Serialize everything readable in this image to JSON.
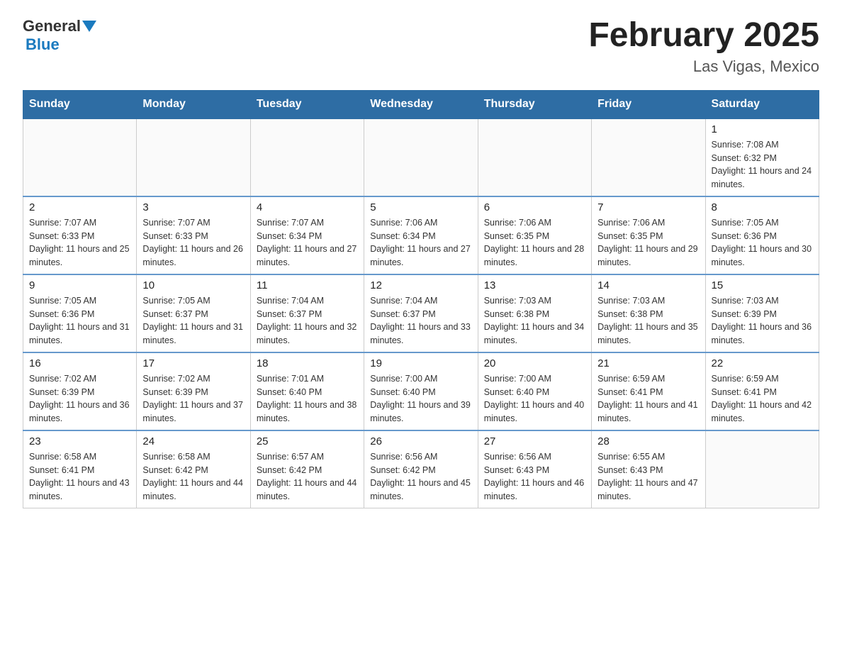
{
  "header": {
    "logo_general": "General",
    "logo_blue": "Blue",
    "title": "February 2025",
    "subtitle": "Las Vigas, Mexico"
  },
  "weekdays": [
    "Sunday",
    "Monday",
    "Tuesday",
    "Wednesday",
    "Thursday",
    "Friday",
    "Saturday"
  ],
  "weeks": [
    [
      {
        "day": "",
        "info": ""
      },
      {
        "day": "",
        "info": ""
      },
      {
        "day": "",
        "info": ""
      },
      {
        "day": "",
        "info": ""
      },
      {
        "day": "",
        "info": ""
      },
      {
        "day": "",
        "info": ""
      },
      {
        "day": "1",
        "info": "Sunrise: 7:08 AM\nSunset: 6:32 PM\nDaylight: 11 hours and 24 minutes."
      }
    ],
    [
      {
        "day": "2",
        "info": "Sunrise: 7:07 AM\nSunset: 6:33 PM\nDaylight: 11 hours and 25 minutes."
      },
      {
        "day": "3",
        "info": "Sunrise: 7:07 AM\nSunset: 6:33 PM\nDaylight: 11 hours and 26 minutes."
      },
      {
        "day": "4",
        "info": "Sunrise: 7:07 AM\nSunset: 6:34 PM\nDaylight: 11 hours and 27 minutes."
      },
      {
        "day": "5",
        "info": "Sunrise: 7:06 AM\nSunset: 6:34 PM\nDaylight: 11 hours and 27 minutes."
      },
      {
        "day": "6",
        "info": "Sunrise: 7:06 AM\nSunset: 6:35 PM\nDaylight: 11 hours and 28 minutes."
      },
      {
        "day": "7",
        "info": "Sunrise: 7:06 AM\nSunset: 6:35 PM\nDaylight: 11 hours and 29 minutes."
      },
      {
        "day": "8",
        "info": "Sunrise: 7:05 AM\nSunset: 6:36 PM\nDaylight: 11 hours and 30 minutes."
      }
    ],
    [
      {
        "day": "9",
        "info": "Sunrise: 7:05 AM\nSunset: 6:36 PM\nDaylight: 11 hours and 31 minutes."
      },
      {
        "day": "10",
        "info": "Sunrise: 7:05 AM\nSunset: 6:37 PM\nDaylight: 11 hours and 31 minutes."
      },
      {
        "day": "11",
        "info": "Sunrise: 7:04 AM\nSunset: 6:37 PM\nDaylight: 11 hours and 32 minutes."
      },
      {
        "day": "12",
        "info": "Sunrise: 7:04 AM\nSunset: 6:37 PM\nDaylight: 11 hours and 33 minutes."
      },
      {
        "day": "13",
        "info": "Sunrise: 7:03 AM\nSunset: 6:38 PM\nDaylight: 11 hours and 34 minutes."
      },
      {
        "day": "14",
        "info": "Sunrise: 7:03 AM\nSunset: 6:38 PM\nDaylight: 11 hours and 35 minutes."
      },
      {
        "day": "15",
        "info": "Sunrise: 7:03 AM\nSunset: 6:39 PM\nDaylight: 11 hours and 36 minutes."
      }
    ],
    [
      {
        "day": "16",
        "info": "Sunrise: 7:02 AM\nSunset: 6:39 PM\nDaylight: 11 hours and 36 minutes."
      },
      {
        "day": "17",
        "info": "Sunrise: 7:02 AM\nSunset: 6:39 PM\nDaylight: 11 hours and 37 minutes."
      },
      {
        "day": "18",
        "info": "Sunrise: 7:01 AM\nSunset: 6:40 PM\nDaylight: 11 hours and 38 minutes."
      },
      {
        "day": "19",
        "info": "Sunrise: 7:00 AM\nSunset: 6:40 PM\nDaylight: 11 hours and 39 minutes."
      },
      {
        "day": "20",
        "info": "Sunrise: 7:00 AM\nSunset: 6:40 PM\nDaylight: 11 hours and 40 minutes."
      },
      {
        "day": "21",
        "info": "Sunrise: 6:59 AM\nSunset: 6:41 PM\nDaylight: 11 hours and 41 minutes."
      },
      {
        "day": "22",
        "info": "Sunrise: 6:59 AM\nSunset: 6:41 PM\nDaylight: 11 hours and 42 minutes."
      }
    ],
    [
      {
        "day": "23",
        "info": "Sunrise: 6:58 AM\nSunset: 6:41 PM\nDaylight: 11 hours and 43 minutes."
      },
      {
        "day": "24",
        "info": "Sunrise: 6:58 AM\nSunset: 6:42 PM\nDaylight: 11 hours and 44 minutes."
      },
      {
        "day": "25",
        "info": "Sunrise: 6:57 AM\nSunset: 6:42 PM\nDaylight: 11 hours and 44 minutes."
      },
      {
        "day": "26",
        "info": "Sunrise: 6:56 AM\nSunset: 6:42 PM\nDaylight: 11 hours and 45 minutes."
      },
      {
        "day": "27",
        "info": "Sunrise: 6:56 AM\nSunset: 6:43 PM\nDaylight: 11 hours and 46 minutes."
      },
      {
        "day": "28",
        "info": "Sunrise: 6:55 AM\nSunset: 6:43 PM\nDaylight: 11 hours and 47 minutes."
      },
      {
        "day": "",
        "info": ""
      }
    ]
  ]
}
